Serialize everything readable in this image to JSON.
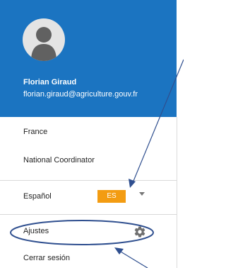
{
  "user": {
    "name": "Florian Giraud",
    "email": "florian.giraud@agriculture.gouv.fr"
  },
  "menu": {
    "country": "France",
    "role": "National Coordinator",
    "language_label": "Español",
    "language_code": "ES",
    "settings_label": "Ajustes",
    "logout_label": "Cerrar sesión"
  },
  "colors": {
    "header": "#1b74c1",
    "badge": "#f39c12",
    "annotation": "#2f4f8f"
  },
  "icons": {
    "avatar": "user-avatar-icon",
    "settings": "gear-icon",
    "dropdown": "caret-down-icon"
  }
}
